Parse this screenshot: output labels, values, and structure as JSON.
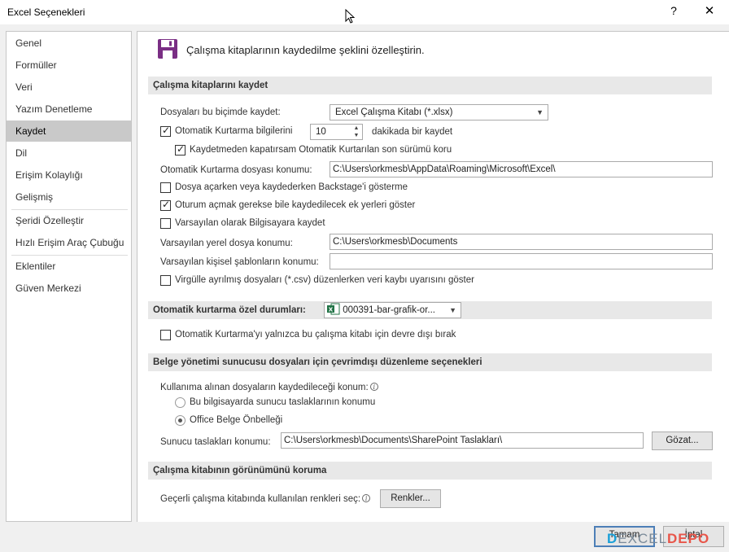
{
  "window": {
    "title": "Excel Seçenekleri",
    "help": "?",
    "close": "✕"
  },
  "nav": {
    "items": [
      {
        "label": "Genel"
      },
      {
        "label": "Formüller"
      },
      {
        "label": "Veri"
      },
      {
        "label": "Yazım Denetleme"
      },
      {
        "label": "Kaydet"
      },
      {
        "label": "Dil"
      },
      {
        "label": "Erişim Kolaylığı"
      },
      {
        "label": "Gelişmiş"
      },
      {
        "label": "Şeridi Özelleştir"
      },
      {
        "label": "Hızlı Erişim Araç Çubuğu"
      },
      {
        "label": "Eklentiler"
      },
      {
        "label": "Güven Merkezi"
      }
    ],
    "active": "Kaydet"
  },
  "header": {
    "icon": "floppy-disk-icon",
    "text": "Çalışma kitaplarının kaydedilme şeklini özelleştirin."
  },
  "save": {
    "section_title": "Çalışma kitaplarını kaydet",
    "format_label": "Dosyaları bu biçimde kaydet:",
    "format_value": "Excel Çalışma Kitabı (*.xlsx)",
    "autorecover_label": "Otomatik Kurtarma bilgilerini",
    "autorecover_checked": true,
    "autorecover_minutes": "10",
    "autorecover_suffix": "dakikada bir kaydet",
    "keep_last_label": "Kaydetmeden kapatırsam Otomatik Kurtarılan son sürümü koru",
    "keep_last_checked": true,
    "autorecover_location_label": "Otomatik Kurtarma dosyası konumu:",
    "autorecover_location_value": "C:\\Users\\orkmesb\\AppData\\Roaming\\Microsoft\\Excel\\",
    "no_backstage_label": "Dosya açarken veya kaydederken Backstage'i gösterme",
    "no_backstage_checked": false,
    "show_additional_label": "Oturum açmak gerekse bile kaydedilecek ek yerleri göster",
    "show_additional_checked": true,
    "save_to_computer_label": "Varsayılan olarak Bilgisayara kaydet",
    "save_to_computer_checked": false,
    "default_local_label": "Varsayılan yerel dosya konumu:",
    "default_local_value": "C:\\Users\\orkmesb\\Documents",
    "personal_templates_label": "Varsayılan kişisel şablonların konumu:",
    "personal_templates_value": "",
    "csv_warning_label": "Virgülle ayrılmış dosyaları (*.csv) düzenlerken veri kaybı uyarısını göster",
    "csv_warning_checked": false
  },
  "autorecover_exceptions": {
    "section_title": "Otomatik kurtarma özel durumları:",
    "workbook_value": "000391-bar-grafik-or...",
    "workbook_icon": "excel-file-icon",
    "disable_label": "Otomatik Kurtarma'yı yalnızca bu çalışma kitabı için devre dışı bırak",
    "disable_checked": false
  },
  "offline": {
    "section_title": "Belge yönetimi sunucusu dosyaları için çevrimdışı düzenleme seçenekleri",
    "checked_out_label": "Kullanıma alınan dosyaların kaydedileceği konum:",
    "option_server_drafts": "Bu bilgisayarda sunucu taslaklarının konumu",
    "option_office_cache": "Office Belge Önbelleği",
    "selected": "Office Belge Önbelleği",
    "server_drafts_label": "Sunucu taslakları konumu:",
    "server_drafts_value": "C:\\Users\\orkmesb\\Documents\\SharePoint Taslakları\\",
    "browse_label": "Gözat..."
  },
  "preserve": {
    "section_title": "Çalışma kitabının görünümünü koruma",
    "colors_label": "Geçerli çalışma kitabında kullanılan renkleri seç:",
    "colors_button": "Renkler..."
  },
  "footer": {
    "ok_label": "Tamam",
    "cancel_label": "İptal"
  },
  "watermark": {
    "part1": "D",
    "part2": "EXCEL",
    "part3": "DEPO"
  }
}
